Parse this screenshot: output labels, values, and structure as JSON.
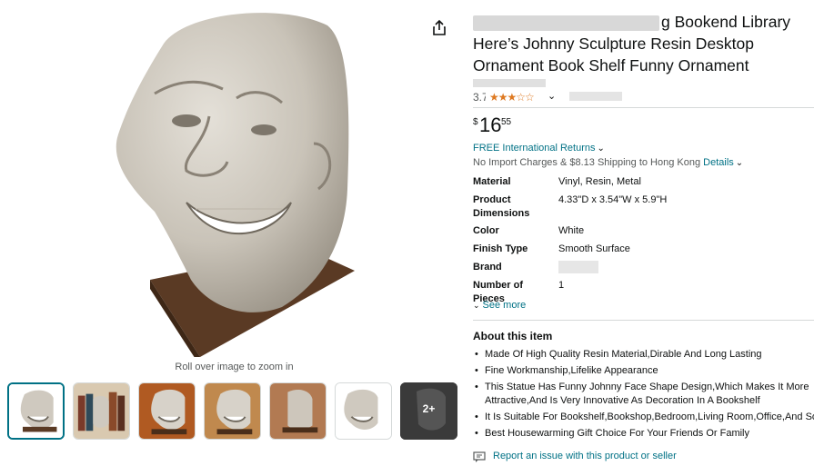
{
  "product": {
    "title_visible": "g Bookend Library Here’s Johnny Sculpture Resin Desktop Ornament Book Shelf Funny Ornament",
    "rating_value": "3.7",
    "rating_stars": "★★★☆☆",
    "price": {
      "symbol": "$",
      "whole": "16",
      "fraction": "55"
    },
    "returns": "FREE International Returns",
    "shipping_text": "No Import Charges & $8.13 Shipping to Hong Kong",
    "shipping_details": "Details",
    "zoom_hint": "Roll over image to zoom in",
    "more_images": "2+"
  },
  "specs": [
    {
      "key": "Material",
      "value": "Vinyl, Resin, Metal"
    },
    {
      "key": "Product Dimensions",
      "value": "4.33\"D x 3.54\"W x 5.9\"H"
    },
    {
      "key": "Color",
      "value": "White"
    },
    {
      "key": "Finish Type",
      "value": "Smooth Surface"
    },
    {
      "key": "Brand",
      "value": ""
    },
    {
      "key": "Number of Pieces",
      "value": "1"
    }
  ],
  "see_more": "See more",
  "about": {
    "title": "About this item",
    "bullets": [
      "Made Of High Quality Resin Material,Dirable And Long Lasting",
      "Fine Workmanship,Lifelike Appearance",
      "This Statue Has Funny Johnny Face Shape Design,Which Makes It More Attractive,And Is Very Innovative As Decoration In A Bookshelf",
      "It Is Suitable For Bookshelf,Bookshop,Bedroom,Living Room,Office,And So O",
      "Best Housewarming Gift Choice For Your Friends Or Family"
    ]
  },
  "report_link": "Report an issue with this product or seller",
  "colors": {
    "link": "#007185",
    "star": "#de7921",
    "text": "#0f1111",
    "muted": "#565959"
  },
  "icons": [
    "share-icon",
    "chevron-down-icon",
    "report-icon",
    "star-icon"
  ]
}
